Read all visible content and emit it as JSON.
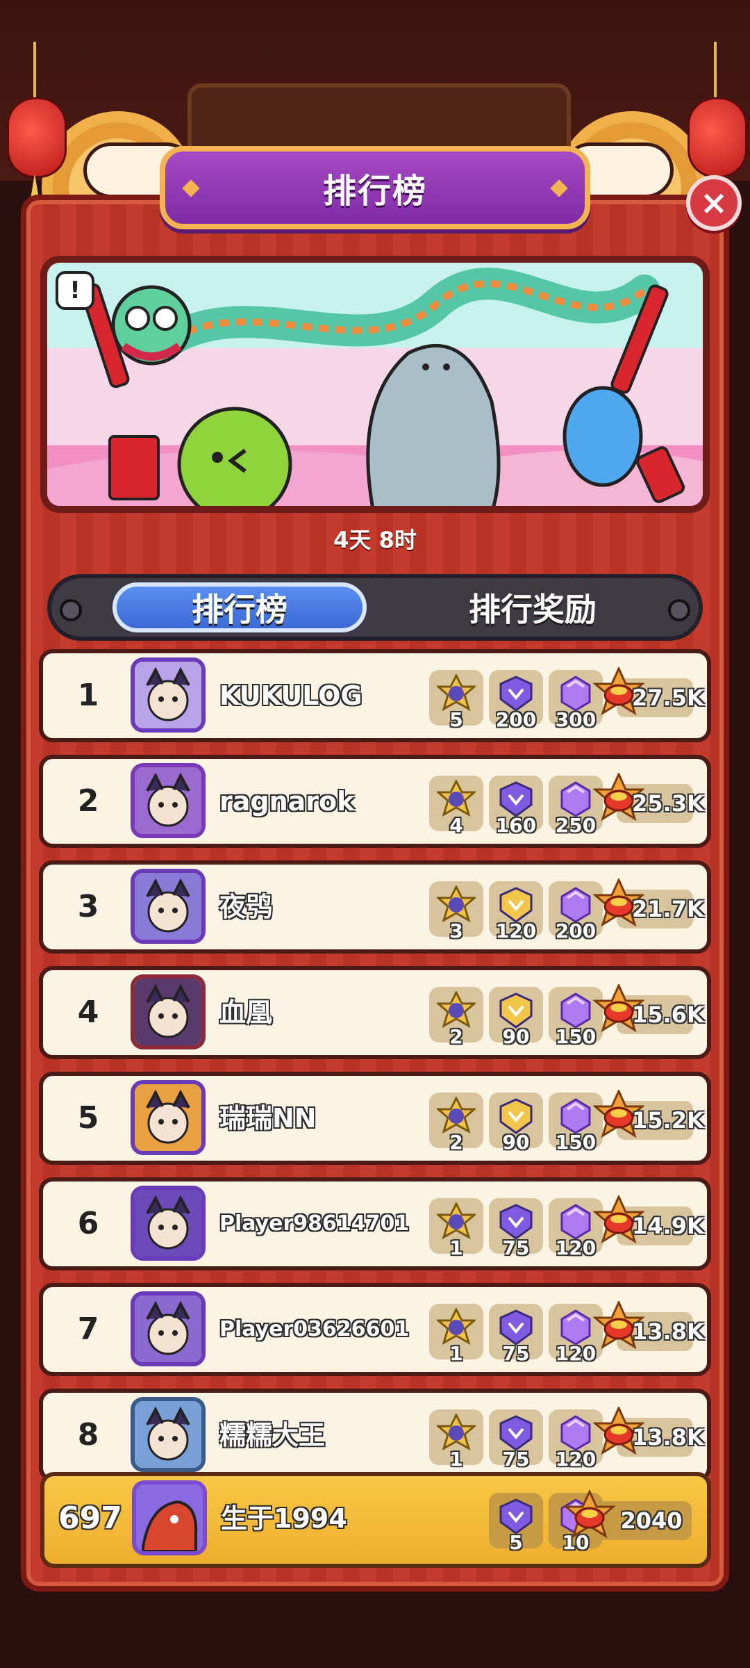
{
  "header": {
    "title": "排行榜",
    "close_label": "×"
  },
  "banner": {
    "info_icon": "!"
  },
  "timer": "4天 8时",
  "tabs": [
    {
      "label": "排行榜",
      "active": true
    },
    {
      "label": "排行奖励",
      "active": false
    }
  ],
  "colors": {
    "tab_active": "#4a7ee6",
    "panel": "#c43a2c",
    "me_row": "#f4bc3a",
    "gem": "#a45ee8"
  },
  "rows": [
    {
      "rank": "1",
      "name": "KUKULOG",
      "medal": "5",
      "r1": "200",
      "r2": "300",
      "score": "27.5K"
    },
    {
      "rank": "2",
      "name": "ragnarok",
      "medal": "4",
      "r1": "160",
      "r2": "250",
      "score": "25.3K"
    },
    {
      "rank": "3",
      "name": "夜鸮",
      "medal": "3",
      "r1": "120",
      "r2": "200",
      "score": "21.7K"
    },
    {
      "rank": "4",
      "name": "血凰",
      "medal": "2",
      "r1": "90",
      "r2": "150",
      "score": "15.6K"
    },
    {
      "rank": "5",
      "name": "瑞瑞NN",
      "medal": "2",
      "r1": "90",
      "r2": "150",
      "score": "15.2K"
    },
    {
      "rank": "6",
      "name": "Player98614701",
      "medal": "1",
      "r1": "75",
      "r2": "120",
      "score": "14.9K"
    },
    {
      "rank": "7",
      "name": "Player03626601",
      "medal": "1",
      "r1": "75",
      "r2": "120",
      "score": "13.8K"
    },
    {
      "rank": "8",
      "name": "糯糯大王",
      "medal": "1",
      "r1": "75",
      "r2": "120",
      "score": "13.8K"
    }
  ],
  "me": {
    "rank": "697",
    "name": "生于1994",
    "r1": "5",
    "r2": "10",
    "score": "2040"
  }
}
